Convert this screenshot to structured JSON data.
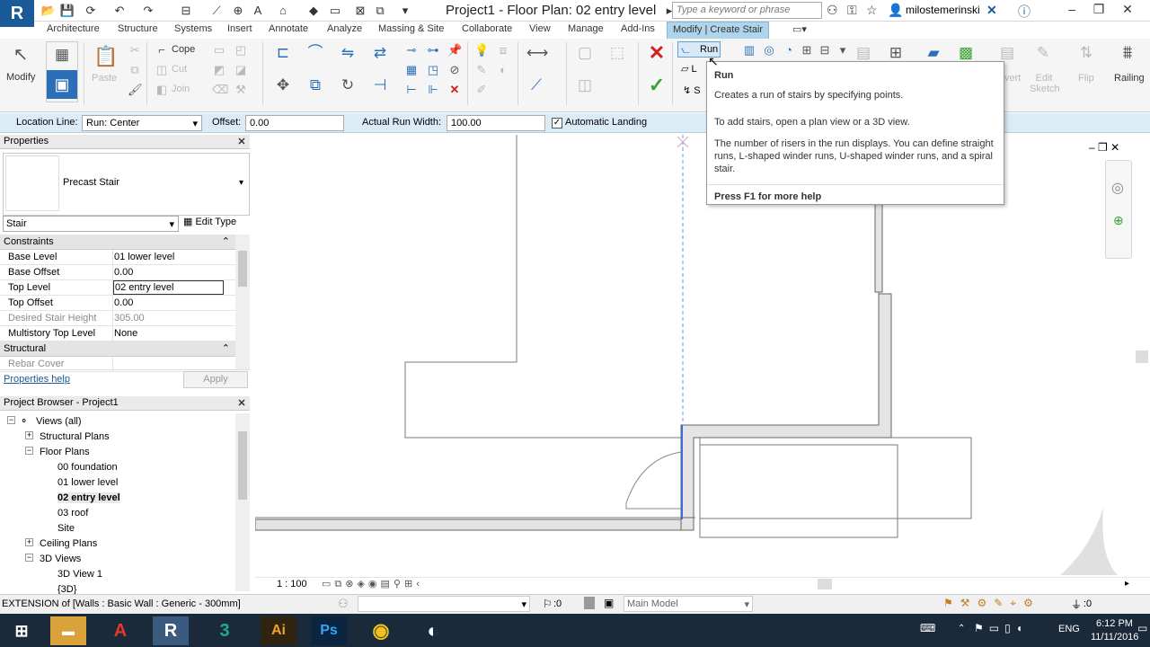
{
  "app": {
    "logo": "R",
    "window_title": "Project1 - Floor Plan: 02 entry level",
    "search_placeholder": "Type a keyword or phrase",
    "user": "milostemerinski"
  },
  "tabs": [
    "Architecture",
    "Structure",
    "Systems",
    "Insert",
    "Annotate",
    "Analyze",
    "Massing & Site",
    "Collaborate",
    "View",
    "Manage",
    "Add-Ins",
    "Modify | Create Stair"
  ],
  "ribbon": {
    "modify_label": "Modify",
    "paste_label": "Paste",
    "cope_label": "Cope",
    "cut_label": "Cut",
    "join_label": "Join",
    "run_label": "Run",
    "landing_label": "L",
    "support_label": "S",
    "convert_label": "vert",
    "edit_sketch_label": "Edit Sketch",
    "flip_label": "Flip",
    "railing_label": "Railing"
  },
  "options_bar": {
    "location_line_label": "Location Line:",
    "location_line_value": "Run: Center",
    "offset_label": "Offset:",
    "offset_value": "0.00",
    "run_width_label": "Actual Run Width:",
    "run_width_value": "100.00",
    "auto_landing_label": "Automatic Landing",
    "auto_landing_checked": true
  },
  "properties": {
    "title": "Properties",
    "type_name": "Precast Stair",
    "filter_value": "Stair",
    "edit_type_label": "Edit Type",
    "groups": [
      {
        "name": "Constraints",
        "rows": [
          {
            "name": "Base Level",
            "value": "01 lower level",
            "gray": false
          },
          {
            "name": "Base Offset",
            "value": "0.00",
            "gray": false
          },
          {
            "name": "Top Level",
            "value": "02 entry level",
            "gray": false,
            "editing": true
          },
          {
            "name": "Top Offset",
            "value": "0.00",
            "gray": false
          },
          {
            "name": "Desired Stair Height",
            "value": "305.00",
            "gray": true
          },
          {
            "name": "Multistory Top Level",
            "value": "None",
            "gray": false
          }
        ]
      },
      {
        "name": "Structural",
        "rows": [
          {
            "name": "Rebar Cover",
            "value": "",
            "gray": true
          }
        ]
      }
    ],
    "help_link": "Properties help",
    "apply_label": "Apply"
  },
  "browser": {
    "title": "Project Browser - Project1",
    "items": [
      {
        "label": "Views (all)",
        "level": 0,
        "toggle": "−",
        "bold": false
      },
      {
        "label": "Structural Plans",
        "level": 1,
        "toggle": "+",
        "bold": false
      },
      {
        "label": "Floor Plans",
        "level": 1,
        "toggle": "−",
        "bold": false
      },
      {
        "label": "00 foundation",
        "level": 2,
        "toggle": "",
        "bold": false
      },
      {
        "label": "01 lower level",
        "level": 2,
        "toggle": "",
        "bold": false
      },
      {
        "label": "02 entry level",
        "level": 2,
        "toggle": "",
        "bold": true
      },
      {
        "label": "03 roof",
        "level": 2,
        "toggle": "",
        "bold": false
      },
      {
        "label": "Site",
        "level": 2,
        "toggle": "",
        "bold": false
      },
      {
        "label": "Ceiling Plans",
        "level": 1,
        "toggle": "+",
        "bold": false
      },
      {
        "label": "3D Views",
        "level": 1,
        "toggle": "−",
        "bold": false
      },
      {
        "label": "3D View 1",
        "level": 2,
        "toggle": "",
        "bold": false
      },
      {
        "label": "{3D}",
        "level": 2,
        "toggle": "",
        "bold": false
      }
    ]
  },
  "tooltip": {
    "title": "Run",
    "line1": "Creates a run of stairs by specifying points.",
    "line2": "To add stairs, open a plan view or a 3D view.",
    "line3": "The number of risers in the run displays. You can define straight runs, L-shaped winder runs, U-shaped winder runs, and a spiral stair.",
    "help": "Press F1 for more help"
  },
  "view": {
    "scale": "1 : 100"
  },
  "status": {
    "message": "EXTENSION  of [Walls : Basic Wall : Generic - 300mm]",
    "worksets": ":0",
    "model": "Main Model",
    "filter": ":0"
  },
  "taskbar": {
    "language": "ENG",
    "time": "6:12 PM",
    "date": "11/11/2016"
  },
  "colors": {
    "accent": "#1a5a99",
    "active_tab": "#aed5ec",
    "options_bar": "#dcecf7",
    "taskbar": "#1b2a3a"
  }
}
